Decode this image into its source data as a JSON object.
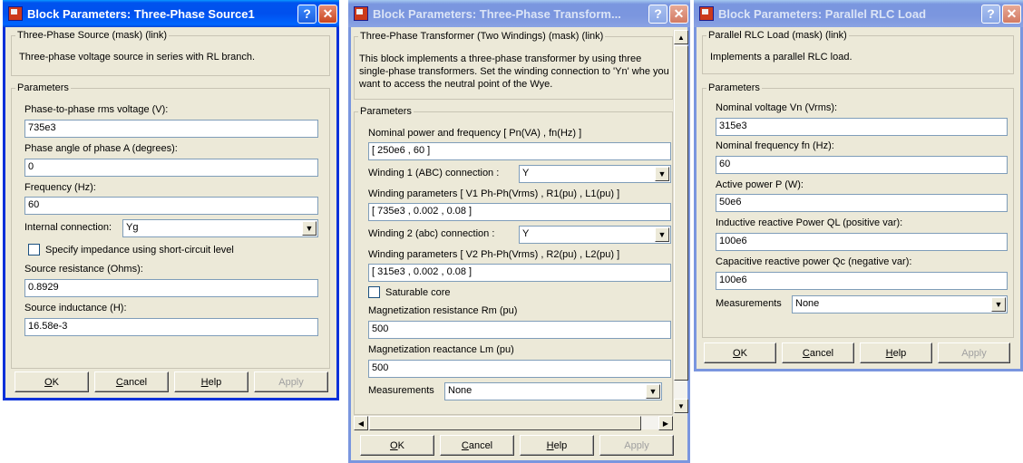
{
  "dialogs": [
    {
      "title": "Block Parameters: Three-Phase Source1",
      "block_header": "Three-Phase Source (mask) (link)",
      "description": "Three-phase voltage source in series with RL branch.",
      "params_header": "Parameters",
      "fields": [
        {
          "label": "Phase-to-phase rms voltage (V):",
          "value": "735e3"
        },
        {
          "label": "Phase angle of phase A (degrees):",
          "value": "0"
        },
        {
          "label": "Frequency (Hz):",
          "value": "60"
        },
        {
          "label": "Internal connection:",
          "value": "Yg"
        },
        {
          "label": "Specify impedance using short-circuit level",
          "checked": false
        },
        {
          "label": "Source resistance (Ohms):",
          "value": "0.8929"
        },
        {
          "label": "Source inductance (H):",
          "value": "16.58e-3"
        }
      ],
      "buttons": {
        "ok": "OK",
        "cancel": "Cancel",
        "help": "Help",
        "apply": "Apply"
      }
    },
    {
      "title": "Block Parameters: Three-Phase Transform...",
      "block_header": "Three-Phase Transformer (Two Windings) (mask) (link)",
      "description": "This block implements a three-phase transformer by using three single-phase transformers. Set the winding connection to 'Yn'  whe you want to access the neutral point of the Wye.",
      "params_header": "Parameters",
      "fields": [
        {
          "label": "Nominal power and frequency  [ Pn(VA) , fn(Hz) ]",
          "value": "[ 250e6 , 60 ]"
        },
        {
          "label": "Winding 1 (ABC) connection :",
          "value": "Y"
        },
        {
          "label": "Winding parameters [ V1 Ph-Ph(Vrms) , R1(pu) , L1(pu) ]",
          "value": "[ 735e3 , 0.002 , 0.08 ]"
        },
        {
          "label": "Winding 2 (abc) connection :",
          "value": "Y"
        },
        {
          "label": "Winding parameters [ V2 Ph-Ph(Vrms) , R2(pu) , L2(pu) ]",
          "value": "[ 315e3 , 0.002 , 0.08 ]"
        },
        {
          "label": "Saturable core",
          "checked": false
        },
        {
          "label": "Magnetization resistance  Rm (pu)",
          "value": "500"
        },
        {
          "label": "Magnetization reactance  Lm (pu)",
          "value": "500"
        },
        {
          "label": "Measurements",
          "value": "None"
        }
      ],
      "buttons": {
        "ok": "OK",
        "cancel": "Cancel",
        "help": "Help",
        "apply": "Apply"
      }
    },
    {
      "title": "Block Parameters: Parallel RLC Load",
      "block_header": "Parallel RLC Load (mask) (link)",
      "description": "Implements a parallel RLC load.",
      "params_header": "Parameters",
      "fields": [
        {
          "label": "Nominal voltage Vn (Vrms):",
          "value": "315e3"
        },
        {
          "label": "Nominal frequency fn (Hz):",
          "value": "60"
        },
        {
          "label": "Active power P (W):",
          "value": "50e6"
        },
        {
          "label": "Inductive reactive Power QL (positive var):",
          "value": "100e6"
        },
        {
          "label": "Capacitive reactive power Qc (negative var):",
          "value": "100e6"
        },
        {
          "label": "Measurements",
          "value": "None"
        }
      ],
      "buttons": {
        "ok": "OK",
        "cancel": "Cancel",
        "help": "Help",
        "apply": "Apply"
      }
    }
  ],
  "titlebar_buttons": {
    "help": "?",
    "close": "✕"
  },
  "icons": [
    "simulink-block-icon",
    "help-icon",
    "close-icon",
    "chevron-down-icon",
    "arrow-up-icon",
    "arrow-down-icon",
    "arrow-left-icon",
    "arrow-right-icon"
  ],
  "colors": {
    "active_titlebar": "#0053ee",
    "inactive_titlebar": "#7a96df",
    "dialog_face": "#ece9d8",
    "field_border": "#7f9db9"
  }
}
